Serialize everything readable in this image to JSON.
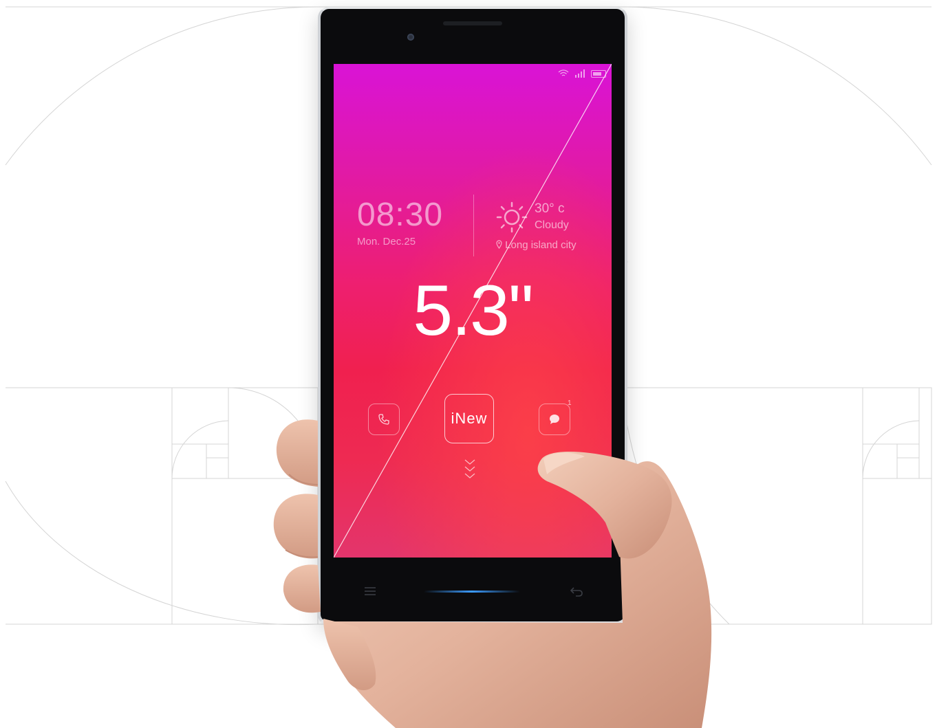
{
  "lock_screen": {
    "time": "08:30",
    "date": "Mon. Dec.25",
    "weather": {
      "temperature": "30° c",
      "condition": "Cloudy",
      "location": "Long island city"
    },
    "screen_size": "5.3\"",
    "center_button_label": "iNew",
    "message_badge": "1"
  },
  "icons": [
    "wifi-icon",
    "signal-icon",
    "battery-icon",
    "sun-icon",
    "location-pin-icon",
    "phone-icon",
    "message-icon",
    "chevron-down-icon",
    "menu-icon",
    "back-icon"
  ],
  "colors": {
    "screen_top": "#d913d6",
    "screen_mid": "#ee1f6f",
    "screen_bottom": "#e3356c",
    "home_glow": "#3c9cff",
    "bezel": "#0b0b0d"
  }
}
